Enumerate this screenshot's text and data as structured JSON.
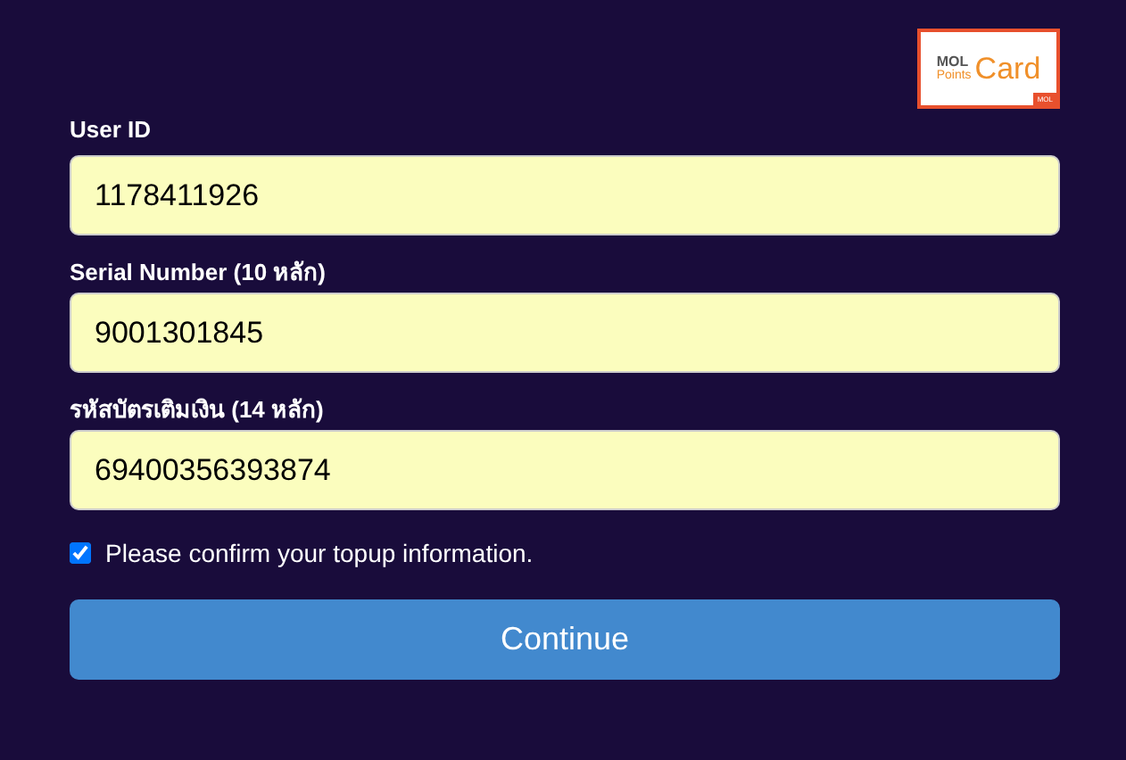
{
  "logo": {
    "brand": "MOL",
    "sub": "Points",
    "word": "Card",
    "tag": "MOL"
  },
  "fields": [
    {
      "label": "User ID",
      "value": "1178411926"
    },
    {
      "label": "Serial Number (10 หลัก)",
      "value": "9001301845"
    },
    {
      "label": "รหัสบัตรเติมเงิน (14 หลัก)",
      "value": "69400356393874"
    }
  ],
  "confirm": {
    "label": "Please confirm your topup information.",
    "checked": true
  },
  "button": "Continue"
}
